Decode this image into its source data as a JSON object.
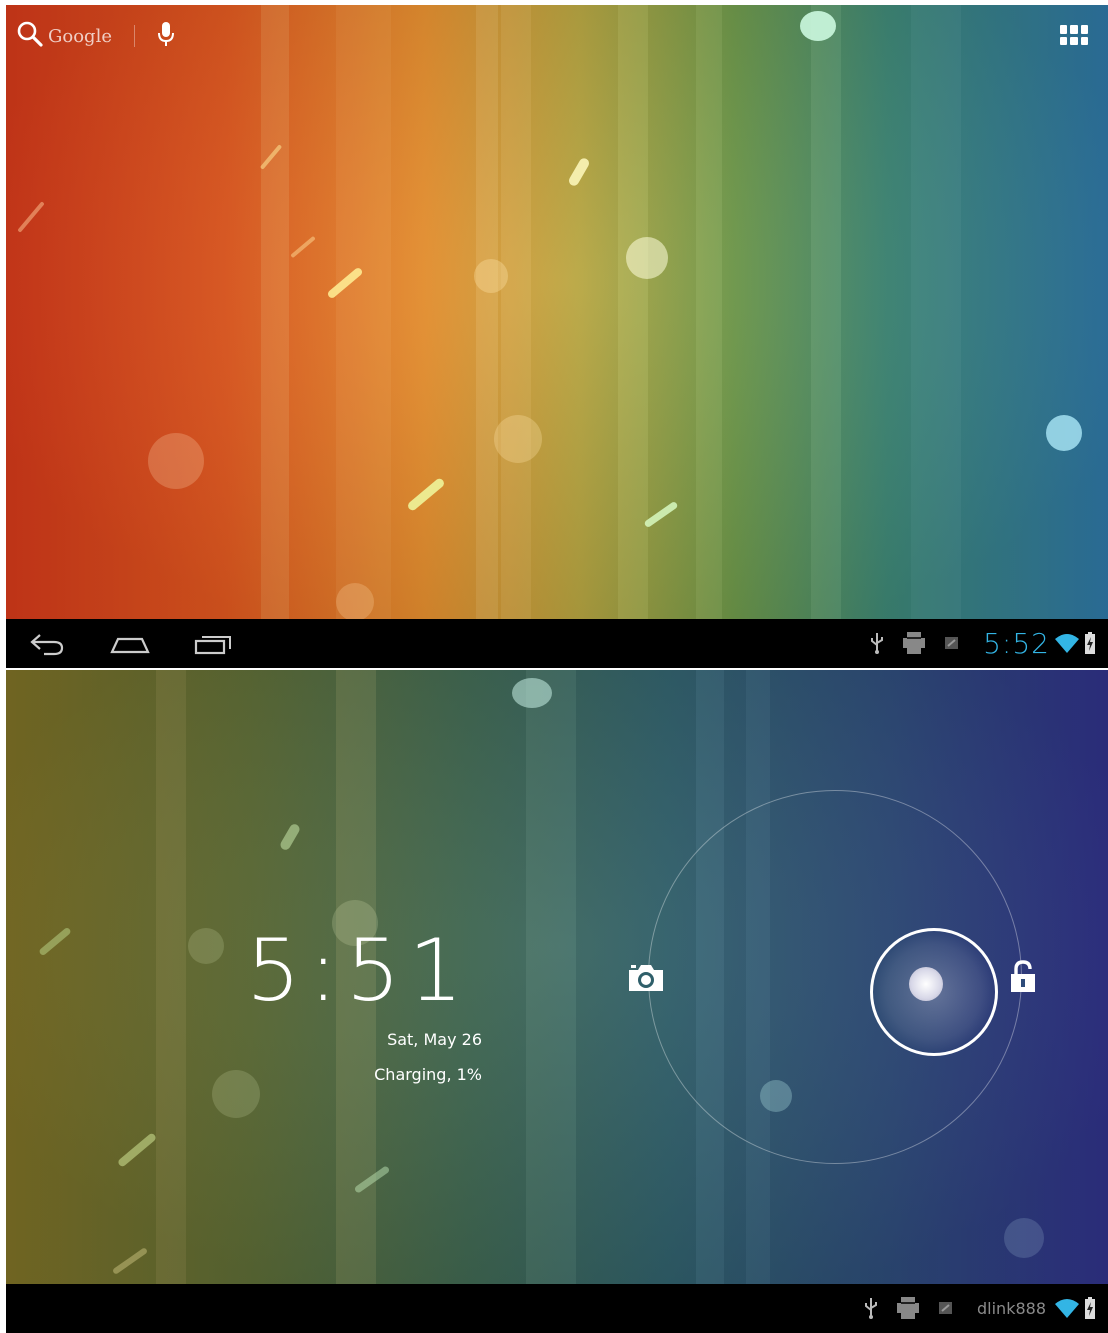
{
  "home_screen": {
    "search": {
      "label": "Google",
      "icon": "search-icon",
      "voice_icon": "microphone-icon"
    },
    "apps_icon": "app-drawer-icon",
    "navigation": {
      "back_icon": "back-icon",
      "home_icon": "home-icon",
      "recents_icon": "recent-apps-icon"
    },
    "status_bar": {
      "icons": [
        "usb-icon",
        "android-debug-icon",
        "notification-icon",
        "wifi-icon",
        "battery-charging-icon"
      ],
      "time": "5:52",
      "time_color": "#33b5e5"
    }
  },
  "lock_screen": {
    "clock": "5:51",
    "date": "Sat, May 26",
    "status": "Charging, 1%",
    "targets": {
      "left_icon": "camera-icon",
      "right_icon": "unlock-icon",
      "handle": "unlock-handle"
    },
    "status_bar": {
      "icons": [
        "usb-icon",
        "android-debug-icon",
        "notification-icon",
        "wifi-icon",
        "battery-charging-icon"
      ],
      "network": "dlink888"
    }
  }
}
